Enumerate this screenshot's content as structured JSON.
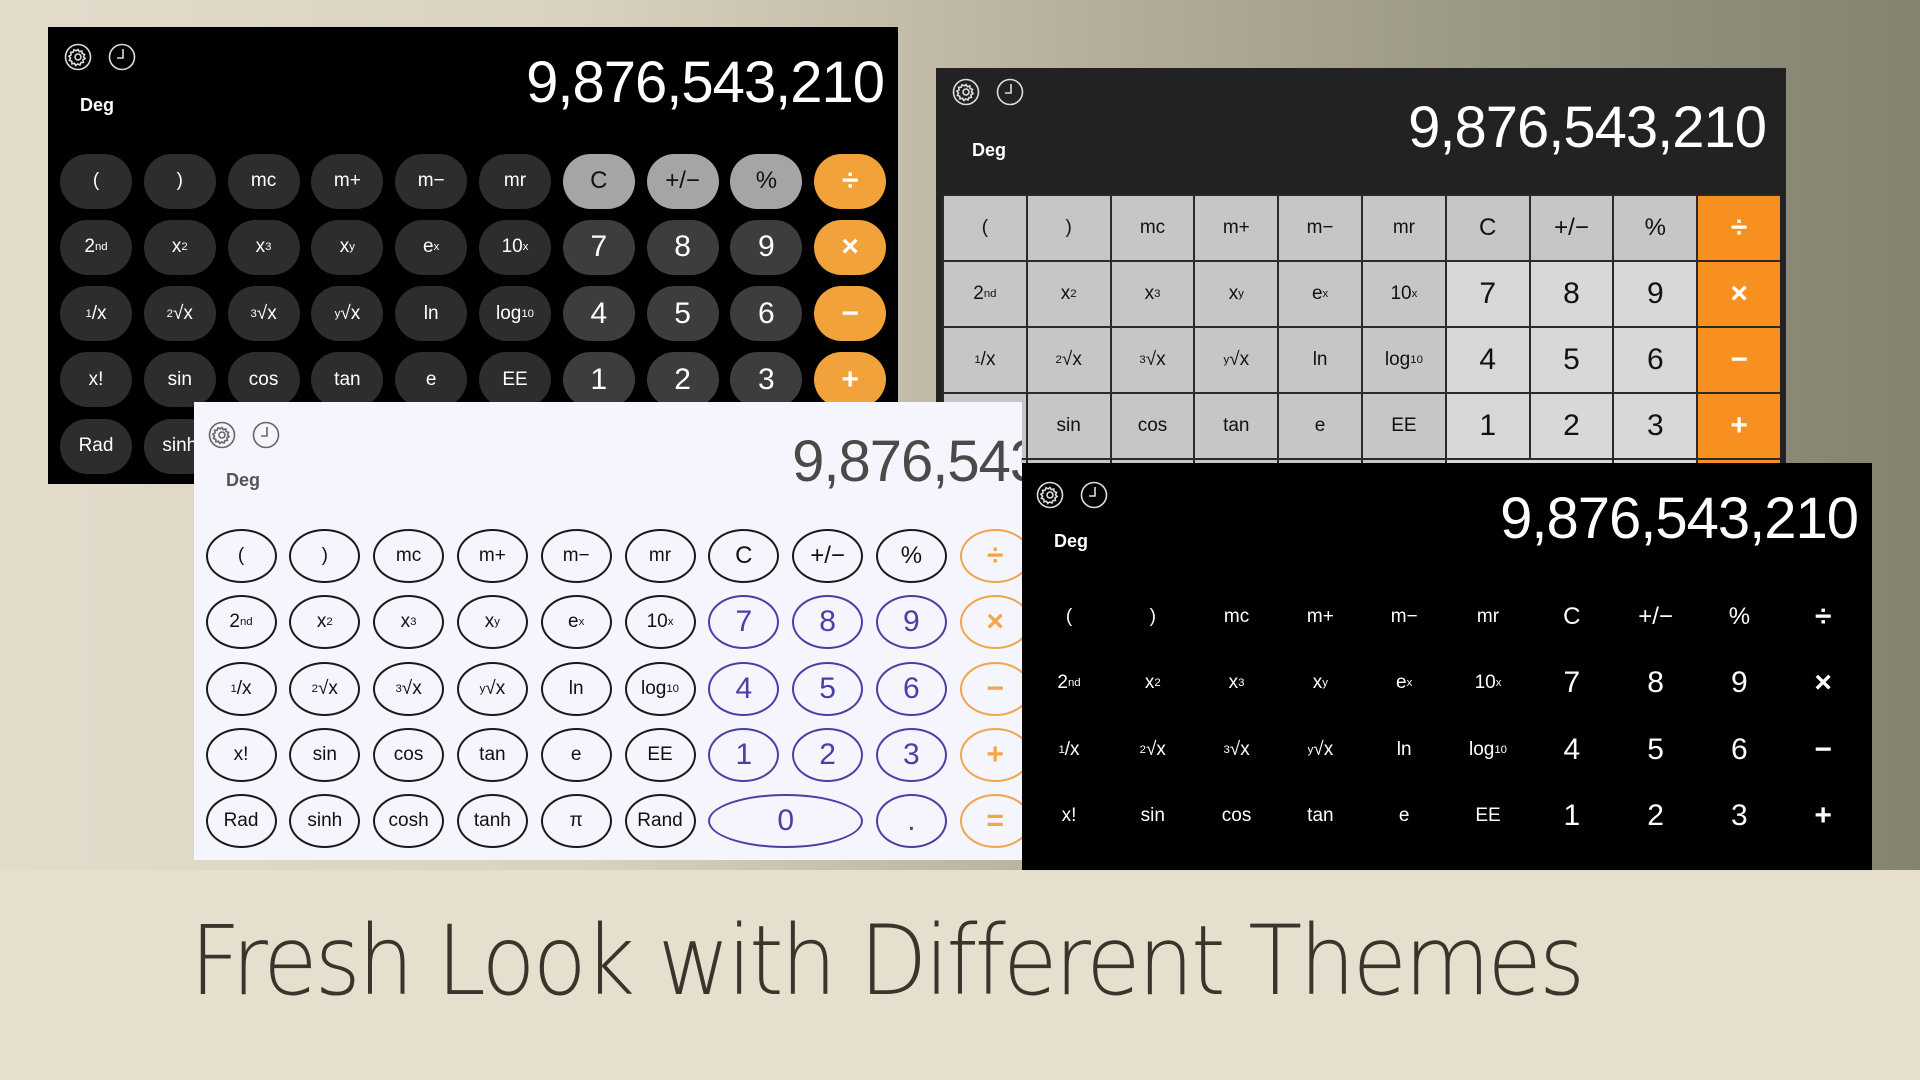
{
  "caption": "Fresh Look with Different Themes",
  "colors": {
    "orange_accent": "#f7901e",
    "orange_soft": "#f1a23a",
    "white_theme_digit": "#4b3fa6",
    "white_theme_operator": "#f2a54a",
    "grey_theme_function_key": "#c4c6c7",
    "grey_theme_digit_key": "#d6d8da"
  },
  "themes": [
    {
      "name": "dark-rounded",
      "angle_mode": "Deg",
      "display_value": "9,876,543,210",
      "icons": [
        "settings-gear-icon",
        "history-clock-icon"
      ]
    },
    {
      "name": "grey-grid",
      "angle_mode": "Deg",
      "display_value": "9,876,543,210",
      "icons": [
        "settings-gear-icon",
        "history-clock-icon"
      ]
    },
    {
      "name": "white-outlined",
      "angle_mode": "Deg",
      "display_value": "9,876,543,210",
      "icons": [
        "settings-gear-icon",
        "history-clock-icon"
      ]
    },
    {
      "name": "black-flat",
      "angle_mode": "Deg",
      "display_value": "9,876,543,210",
      "icons": [
        "settings-gear-icon",
        "history-clock-icon"
      ]
    }
  ],
  "keypad": {
    "rows": [
      [
        {
          "id": "open-paren",
          "label": "(",
          "kind": "func"
        },
        {
          "id": "close-paren",
          "label": ")",
          "kind": "func"
        },
        {
          "id": "mc",
          "label": "mc",
          "kind": "func"
        },
        {
          "id": "m-plus",
          "label": "m+",
          "kind": "func"
        },
        {
          "id": "m-minus",
          "label": "m−",
          "kind": "func"
        },
        {
          "id": "mr",
          "label": "mr",
          "kind": "func"
        },
        {
          "id": "clear",
          "label": "C",
          "kind": "func2"
        },
        {
          "id": "plus-minus",
          "label": "+/−",
          "kind": "func2"
        },
        {
          "id": "percent",
          "label": "%",
          "kind": "func2"
        },
        {
          "id": "divide",
          "label": "÷",
          "kind": "op"
        }
      ],
      [
        {
          "id": "second",
          "label": "2",
          "sup": "nd",
          "kind": "func"
        },
        {
          "id": "x-squared",
          "label": "x",
          "sup": "2",
          "kind": "func"
        },
        {
          "id": "x-cubed",
          "label": "x",
          "sup": "3",
          "kind": "func"
        },
        {
          "id": "x-pow-y",
          "label": "x",
          "sup": "y",
          "kind": "func"
        },
        {
          "id": "e-pow-x",
          "label": "e",
          "sup": "x",
          "kind": "func"
        },
        {
          "id": "ten-pow-x",
          "label": "10",
          "sup": "x",
          "kind": "func"
        },
        {
          "id": "seven",
          "label": "7",
          "kind": "digit"
        },
        {
          "id": "eight",
          "label": "8",
          "kind": "digit"
        },
        {
          "id": "nine",
          "label": "9",
          "kind": "digit"
        },
        {
          "id": "multiply",
          "label": "×",
          "kind": "op"
        }
      ],
      [
        {
          "id": "reciprocal",
          "pre": "1",
          "label": "/x",
          "kind": "func"
        },
        {
          "id": "square-root",
          "pre": "2",
          "label": "√x",
          "kind": "func"
        },
        {
          "id": "cube-root",
          "pre": "3",
          "label": "√x",
          "kind": "func"
        },
        {
          "id": "y-root",
          "pre": "y",
          "label": "√x",
          "kind": "func"
        },
        {
          "id": "ln",
          "label": "ln",
          "kind": "func"
        },
        {
          "id": "log10",
          "label": "log",
          "sub": "10",
          "kind": "func"
        },
        {
          "id": "four",
          "label": "4",
          "kind": "digit"
        },
        {
          "id": "five",
          "label": "5",
          "kind": "digit"
        },
        {
          "id": "six",
          "label": "6",
          "kind": "digit"
        },
        {
          "id": "subtract",
          "label": "−",
          "kind": "op"
        }
      ],
      [
        {
          "id": "factorial",
          "label": "x!",
          "kind": "func"
        },
        {
          "id": "sin",
          "label": "sin",
          "kind": "func"
        },
        {
          "id": "cos",
          "label": "cos",
          "kind": "func"
        },
        {
          "id": "tan",
          "label": "tan",
          "kind": "func"
        },
        {
          "id": "e",
          "label": "e",
          "kind": "func"
        },
        {
          "id": "ee",
          "label": "EE",
          "kind": "func"
        },
        {
          "id": "one",
          "label": "1",
          "kind": "digit"
        },
        {
          "id": "two",
          "label": "2",
          "kind": "digit"
        },
        {
          "id": "three",
          "label": "3",
          "kind": "digit"
        },
        {
          "id": "add",
          "label": "+",
          "kind": "op"
        }
      ],
      [
        {
          "id": "rad",
          "label": "Rad",
          "kind": "func"
        },
        {
          "id": "sinh",
          "label": "sinh",
          "kind": "func"
        },
        {
          "id": "cosh",
          "label": "cosh",
          "kind": "func"
        },
        {
          "id": "tanh",
          "label": "tanh",
          "kind": "func"
        },
        {
          "id": "pi",
          "label": "π",
          "kind": "func"
        },
        {
          "id": "rand",
          "label": "Rand",
          "kind": "func"
        },
        {
          "id": "zero",
          "label": "0",
          "kind": "digit",
          "span": 2
        },
        {
          "id": "decimal",
          "label": ".",
          "kind": "digit"
        },
        {
          "id": "equals",
          "label": "=",
          "kind": "op"
        }
      ]
    ]
  }
}
